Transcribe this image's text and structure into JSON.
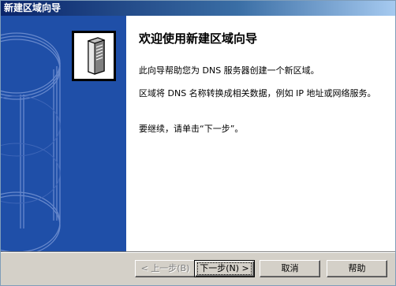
{
  "window": {
    "title": "新建区域向导"
  },
  "wizard": {
    "heading": "欢迎使用新建区域向导",
    "paragraph1": "此向导帮助您为 DNS 服务器创建一个新区域。",
    "paragraph2": "区域将 DNS 名称转换成相关数据，例如 IP 地址或网络服务。",
    "paragraph3": "要继续，请单击“下一步”。"
  },
  "buttons": {
    "back": "< 上一步(B)",
    "next": "下一步(N) >",
    "cancel": "取消",
    "help": "帮助"
  },
  "colors": {
    "sidebar": "#1f4fa8",
    "titlebar_start": "#0a246a",
    "titlebar_end": "#a6caf0",
    "dialog_face": "#d4d0c8"
  },
  "icons": [
    "server-icon"
  ]
}
